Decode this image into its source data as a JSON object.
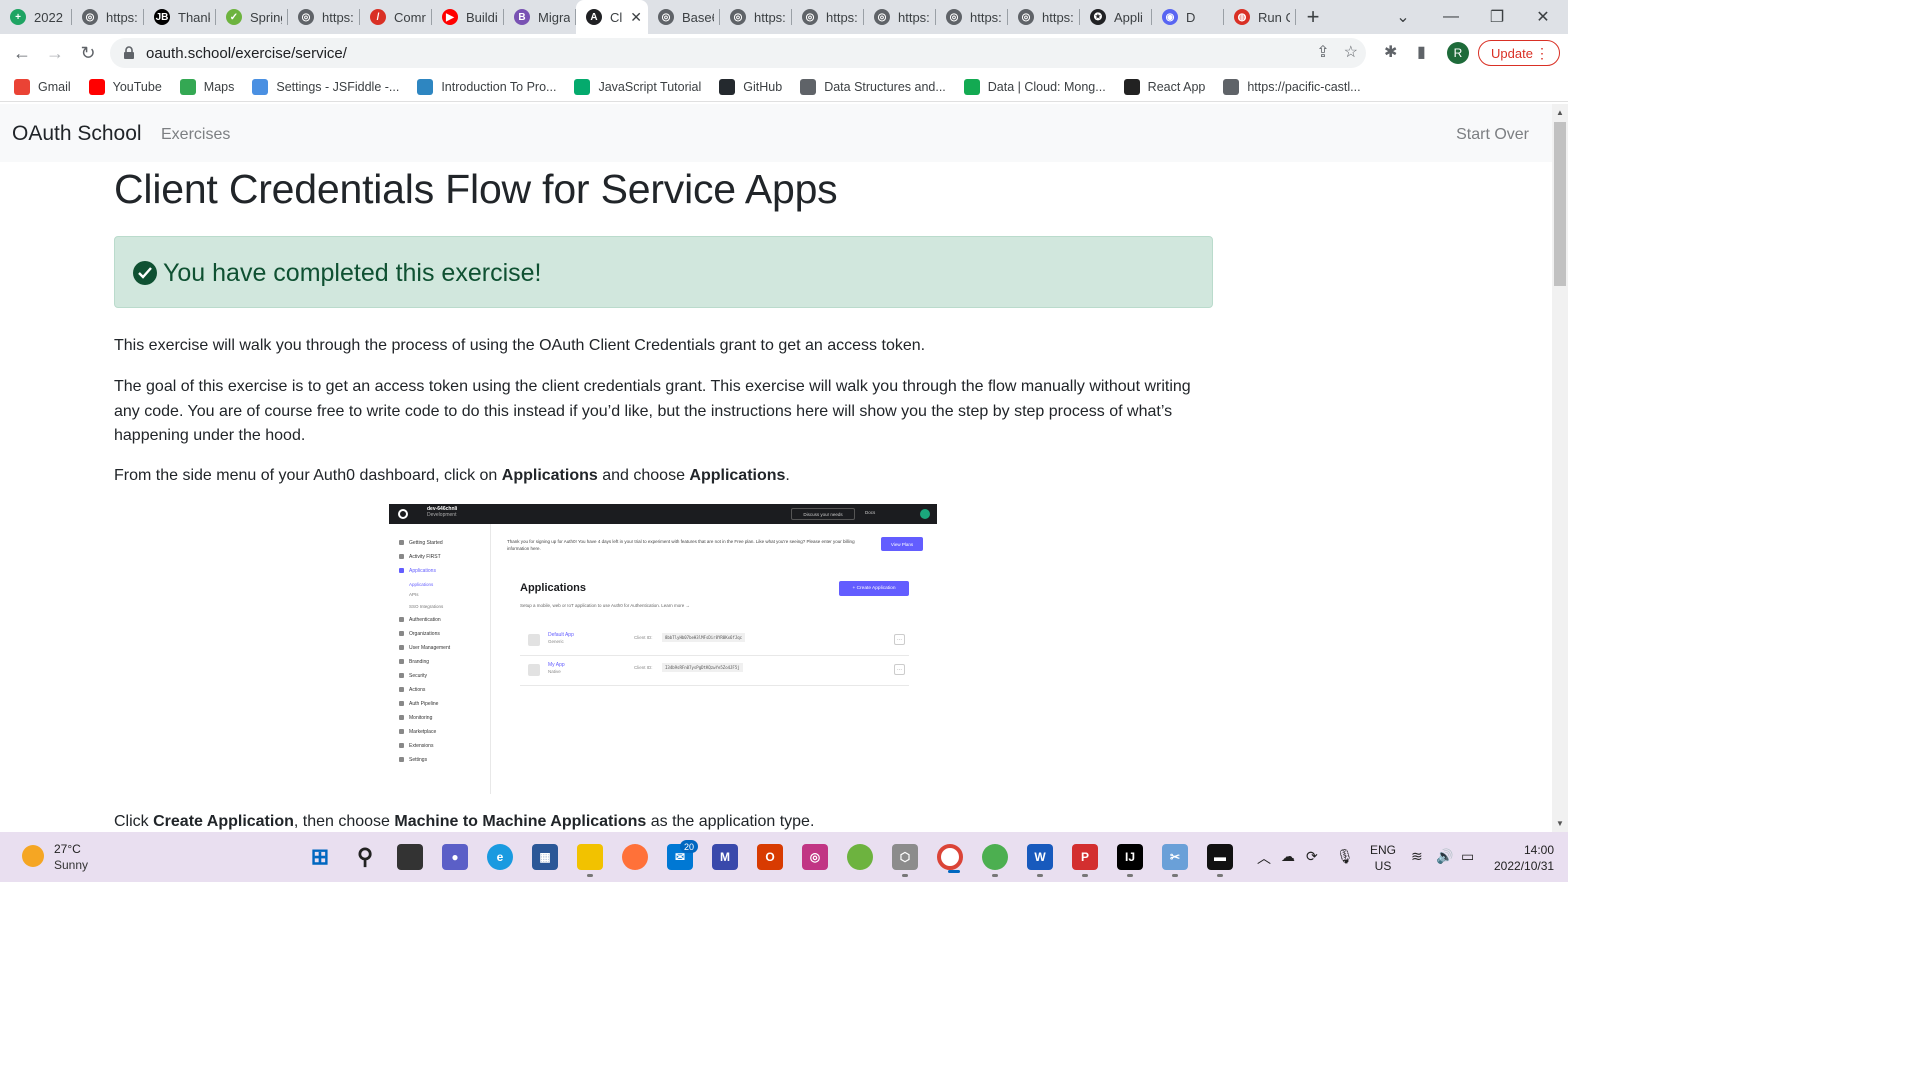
{
  "browser": {
    "tabs": [
      {
        "title": "2022",
        "color": "#1fa463",
        "glyph": "+"
      },
      {
        "title": "https:",
        "color": "#5f6368",
        "glyph": "◎"
      },
      {
        "title": "Thank",
        "color": "#000000",
        "glyph": "JB"
      },
      {
        "title": "Spring",
        "color": "#6db33f",
        "glyph": "✓"
      },
      {
        "title": "https:",
        "color": "#5f6368",
        "glyph": "◎"
      },
      {
        "title": "Comr",
        "color": "#d93025",
        "glyph": "/"
      },
      {
        "title": "Buildi",
        "color": "#ff0000",
        "glyph": "▶"
      },
      {
        "title": "Migra",
        "color": "#7952b3",
        "glyph": "B"
      },
      {
        "title": "Cl",
        "color": "#202124",
        "glyph": "A",
        "active": true
      },
      {
        "title": "Base6",
        "color": "#5f6368",
        "glyph": "◎"
      },
      {
        "title": "https:",
        "color": "#5f6368",
        "glyph": "◎"
      },
      {
        "title": "https:",
        "color": "#5f6368",
        "glyph": "◎"
      },
      {
        "title": "https:",
        "color": "#5f6368",
        "glyph": "◎"
      },
      {
        "title": "https:",
        "color": "#5f6368",
        "glyph": "◎"
      },
      {
        "title": "https:",
        "color": "#5f6368",
        "glyph": "◎"
      },
      {
        "title": "Appli",
        "color": "#202124",
        "glyph": "✪"
      },
      {
        "title": "D",
        "color": "#5865f2",
        "glyph": "◉"
      },
      {
        "title": "Run C",
        "color": "#d93025",
        "glyph": "◍"
      }
    ],
    "new_tab": "+",
    "url": "oauth.school/exercise/service/",
    "profile_initial": "R",
    "update_label": "Update",
    "bookmarks": [
      {
        "label": "Gmail",
        "color": "#ea4335"
      },
      {
        "label": "YouTube",
        "color": "#ff0000"
      },
      {
        "label": "Maps",
        "color": "#34a853"
      },
      {
        "label": "Settings - JSFiddle -...",
        "color": "#4a90e2"
      },
      {
        "label": "Introduction To Pro...",
        "color": "#2e86c1"
      },
      {
        "label": "JavaScript Tutorial",
        "color": "#04aa6d"
      },
      {
        "label": "GitHub",
        "color": "#24292e"
      },
      {
        "label": "Data Structures and...",
        "color": "#5f6368"
      },
      {
        "label": "Data | Cloud: Mong...",
        "color": "#13aa52"
      },
      {
        "label": "React App",
        "color": "#222222"
      },
      {
        "label": "https://pacific-castl...",
        "color": "#5f6368"
      }
    ]
  },
  "site": {
    "brand": "OAuth School",
    "nav_exercises": "Exercises",
    "start_over": "Start Over"
  },
  "content": {
    "title": "Client Credentials Flow for Service Apps",
    "alert": "You have completed this exercise!",
    "para1": "This exercise will walk you through the process of using the OAuth Client Credentials grant to get an access token.",
    "para2": "The goal of this exercise is to get an access token using the client credentials grant. This exercise will walk you through the flow manually without writing any code. You are of course free to write code to do this instead if you’d like, but the instructions here will show you the step by step process of what’s happening under the hood.",
    "para3_prefix": "From the side menu of your Auth0 dashboard, click on ",
    "para3_bold1": "Applications",
    "para3_mid": " and choose ",
    "para3_bold2": "Applications",
    "para3_suffix": ".",
    "para4_prefix": "Click ",
    "para4_bold1": "Create Application",
    "para4_mid": ", then choose ",
    "para4_bold2": "Machine to Machine Applications",
    "para4_suffix": " as the application type."
  },
  "screenshot": {
    "tenant": "dev-646chnli",
    "env": "Development",
    "discuss": "Discuss your needs",
    "docs": "Docs",
    "banner": "Thank you for signing up for Auth0! You have 4 days left in your trial to experiment with features that are not in the Free plan. Like what you're seeing? Please enter your billing information here.",
    "view_plans": "View Plans",
    "heading": "Applications",
    "desc": "Setup a mobile, web or IoT application to use Auth0 for Authentication. Learn more →",
    "create_btn": "+ Create Application",
    "sidebar": [
      {
        "label": "Getting Started"
      },
      {
        "label": "Activity  FIRST"
      },
      {
        "label": "Applications",
        "active": true
      },
      {
        "label": "Authentication"
      },
      {
        "label": "Organizations"
      },
      {
        "label": "User Management"
      },
      {
        "label": "Branding"
      },
      {
        "label": "Security"
      },
      {
        "label": "Actions"
      },
      {
        "label": "Auth Pipeline"
      },
      {
        "label": "Monitoring"
      },
      {
        "label": "Marketplace"
      },
      {
        "label": "Extensions"
      },
      {
        "label": "Settings"
      }
    ],
    "subitems": [
      {
        "label": "Applications",
        "active": true
      },
      {
        "label": "APIs"
      },
      {
        "label": "SSO Integrations"
      }
    ],
    "apps": [
      {
        "name": "Default App",
        "type": "Generic",
        "client_id_label": "Client ID:",
        "client_id": "8bbTlyHb07beH3lMFsDir8YR0Kx6fJqc"
      },
      {
        "name": "My App",
        "type": "Native",
        "client_id_label": "Client ID:",
        "client_id": "I34b9sRFn07ysPgDtKQzwYe5Zo4JF5j"
      }
    ]
  },
  "taskbar": {
    "temp": "27°C",
    "condition": "Sunny",
    "badge": "20",
    "lang1": "ENG",
    "lang2": "US",
    "time": "14:00",
    "date": "2022/10/31"
  }
}
